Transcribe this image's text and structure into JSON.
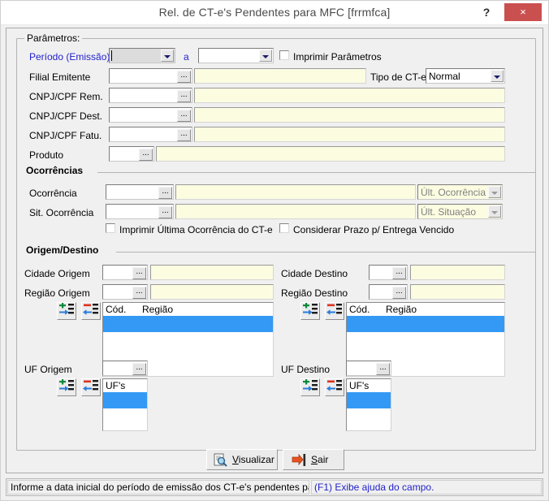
{
  "window": {
    "title": "Rel. de CT-e's Pendentes para MFC [frrmfca]",
    "help_icon": "question-mark-icon",
    "help_label": "?",
    "close_label": "×",
    "close_color": "#c9504f"
  },
  "parametros": {
    "legend": "Parâmetros:",
    "periodo": {
      "label": "Período (Emissão)",
      "label_color": "#2222cc",
      "from_value": "",
      "separator": "a",
      "to_value": "",
      "from_enabled": false,
      "to_enabled": true
    },
    "imprimir_parametros": {
      "label": "Imprimir Parâmetros",
      "checked": false
    },
    "rows": [
      {
        "label": "Filial Emitente",
        "code": "",
        "desc": ""
      },
      {
        "label": "CNPJ/CPF Rem.",
        "code": "",
        "desc": ""
      },
      {
        "label": "CNPJ/CPF Dest.",
        "code": "",
        "desc": ""
      },
      {
        "label": "CNPJ/CPF Fatu.",
        "code": "",
        "desc": ""
      },
      {
        "label": "Produto",
        "code": "",
        "desc": ""
      }
    ],
    "tipo_cte": {
      "label": "Tipo de CT-e",
      "value": "Normal",
      "options": [
        "Normal"
      ]
    },
    "lookup_icon": "ellipsis-icon",
    "lookup_label": "..."
  },
  "ocorrencias": {
    "header": "Ocorrências",
    "rows": [
      {
        "label": "Ocorrência",
        "code": "",
        "desc": "",
        "combo_value": "Últ. Ocorrência",
        "combo_enabled": false
      },
      {
        "label": "Sit. Ocorrência",
        "code": "",
        "desc": "",
        "combo_value": "Últ. Situação",
        "combo_enabled": false
      }
    ],
    "checks": [
      {
        "label": "Imprimir Última Ocorrência do CT-e",
        "checked": false
      },
      {
        "label": "Considerar Prazo p/ Entrega Vencido",
        "checked": false
      }
    ]
  },
  "origem_destino": {
    "header": "Origem/Destino",
    "origem": {
      "cidade_label": "Cidade Origem",
      "cidade_code": "",
      "cidade_desc": "",
      "regiao_label": "Região Origem",
      "regiao_code": "",
      "regiao_desc": "",
      "list_headers": [
        "Cód.",
        "Região"
      ],
      "list_rows": [
        ""
      ],
      "uf_label": "UF Origem",
      "uf_code": "",
      "uf_list_header": "UF's",
      "uf_list_rows": [
        ""
      ]
    },
    "destino": {
      "cidade_label": "Cidade Destino",
      "cidade_code": "",
      "cidade_desc": "",
      "regiao_label": "Região Destino",
      "regiao_code": "",
      "regiao_desc": "",
      "list_headers": [
        "Cód.",
        "Região"
      ],
      "list_rows": [
        ""
      ],
      "uf_label": "UF Destino",
      "uf_code": "",
      "uf_list_header": "UF's",
      "uf_list_rows": [
        ""
      ]
    },
    "add_row_icon": "add-row-icon",
    "remove_row_icon": "remove-row-icon",
    "selection_color": "#3399f5"
  },
  "actions": {
    "visualizar": {
      "label": "Visualizar",
      "accelerator": "V",
      "icon": "preview-magnifier-icon"
    },
    "sair": {
      "label": "Sair",
      "accelerator": "S",
      "icon": "exit-door-arrow-icon"
    }
  },
  "statusbar": {
    "hint": "Informe a data inicial do período de emissão dos CT-e's pendentes pa",
    "help": "(F1) Exibe ajuda do campo.",
    "help_color": "#2222cc"
  }
}
